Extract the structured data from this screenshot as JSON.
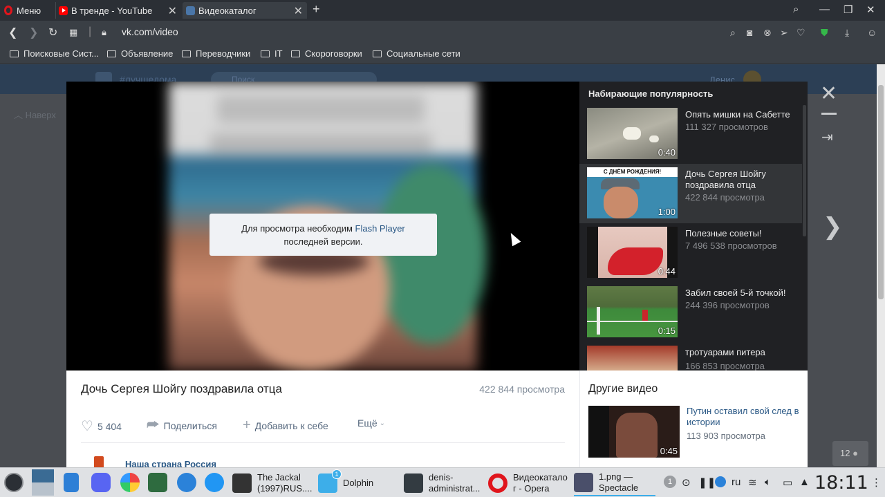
{
  "browser": {
    "menu_label": "Меню",
    "tabs": [
      {
        "title": "В тренде - YouTube"
      },
      {
        "title": "Видеокаталог"
      }
    ],
    "url": "vk.com/video",
    "bookmarks": [
      "Поисковые Сист...",
      "Объявление",
      "Переводчики",
      "IT",
      "Скороговорки",
      "Социальные сети"
    ]
  },
  "vk_page": {
    "header_tag": "#лучшедома",
    "search_placeholder": "Поиск",
    "user_name": "Денис",
    "back_to_top": "Наверх"
  },
  "player": {
    "flash_text_before": "Для просмотра необходим ",
    "flash_link": "Flash Player",
    "flash_text_after": "последней версии."
  },
  "popular": {
    "title": "Набирающие популярность",
    "items": [
      {
        "title": "Опять мишки на Сабетте",
        "views": "111 327 просмотров",
        "duration": "0:40"
      },
      {
        "title": "Дочь Сергея Шойгу поздравила отца",
        "views": "422 844 просмотра",
        "duration": "1:00"
      },
      {
        "title": "Полезные советы!",
        "views": "7 496 538 просмотров",
        "duration": "0:44"
      },
      {
        "title": "Забил своей 5-й точкой!",
        "views": "244 396 просмотров",
        "duration": "0:15"
      },
      {
        "title": "тротуарами питера",
        "views": "166 853 просмотра",
        "duration": ""
      }
    ],
    "thumb_banner": "С ДНЁМ РОЖДЕНИЯ!"
  },
  "video": {
    "title": "Дочь Сергея Шойгу поздравила отца",
    "views": "422 844 просмотра",
    "likes": "5 404",
    "share": "Поделиться",
    "add": "Добавить к себе",
    "more": "Ещё",
    "channel": "Наша страна Россия"
  },
  "other_videos": {
    "title": "Другие видео",
    "item": {
      "title": "Путин оставил свой след в истории",
      "views": "113 903 просмотра",
      "duration": "0:45"
    }
  },
  "counter": "12",
  "taskbar": {
    "tasks": [
      {
        "label": "The Jackal (1997)RUS...."
      },
      {
        "label": "Dolphin",
        "badge": "1"
      },
      {
        "label": "denis-administrat..."
      },
      {
        "label": "Видеокатало г - Opera"
      },
      {
        "label": "1.png — Spectacle"
      }
    ],
    "tray_badge": "1",
    "lang": "ru",
    "clock": "18:11"
  },
  "colors": {
    "vk_link": "#2a5885",
    "opera_red": "#e0151c",
    "youtube_red": "#ff0000",
    "vk_blue": "#4a76a8",
    "kde_accent": "#3daee9"
  }
}
